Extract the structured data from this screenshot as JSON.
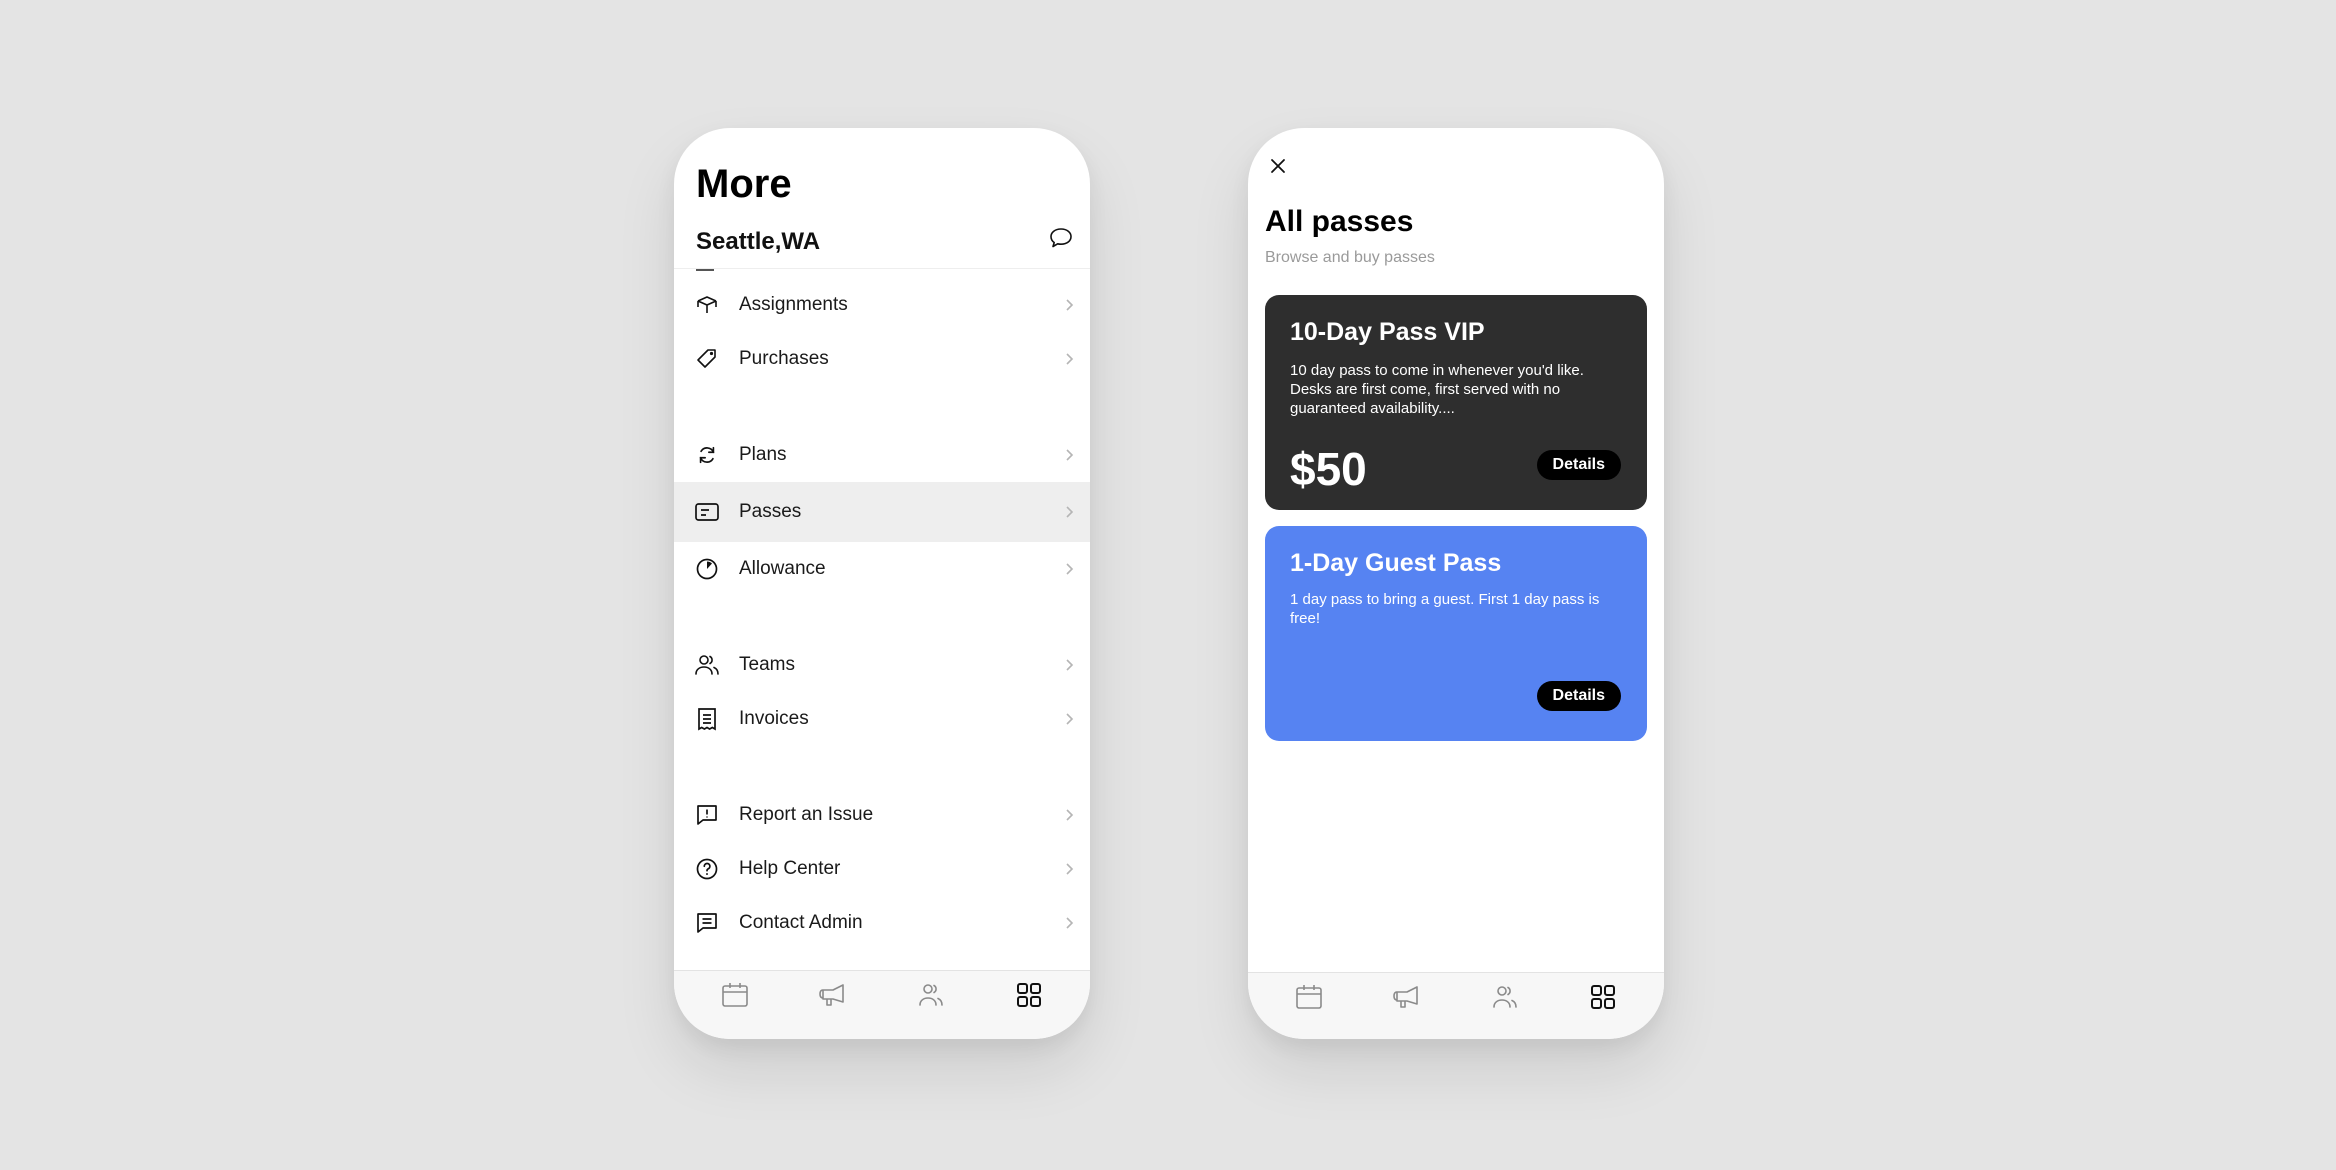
{
  "more_screen": {
    "title": "More",
    "location": "Seattle,WA",
    "chat_icon": "chat-bubble-icon",
    "groups": [
      [
        {
          "label": "Assignments",
          "icon": "box-icon"
        },
        {
          "label": "Purchases",
          "icon": "tag-icon"
        }
      ],
      [
        {
          "label": "Plans",
          "icon": "refresh-icon"
        },
        {
          "label": "Passes",
          "icon": "pass-card-icon",
          "active": true
        },
        {
          "label": "Allowance",
          "icon": "pie-timer-icon"
        }
      ],
      [
        {
          "label": "Teams",
          "icon": "users-icon"
        },
        {
          "label": "Invoices",
          "icon": "receipt-icon"
        }
      ],
      [
        {
          "label": "Report an Issue",
          "icon": "report-bubble-icon"
        },
        {
          "label": "Help Center",
          "icon": "help-circle-icon"
        },
        {
          "label": "Contact Admin",
          "icon": "message-icon"
        }
      ]
    ],
    "tabbar": [
      {
        "name": "calendar",
        "icon": "calendar-icon",
        "active": false
      },
      {
        "name": "announcements",
        "icon": "megaphone-icon",
        "active": false
      },
      {
        "name": "people",
        "icon": "users-icon",
        "active": false
      },
      {
        "name": "more",
        "icon": "grid-icon",
        "active": true
      }
    ]
  },
  "passes_screen": {
    "close_icon": "close-icon",
    "title": "All passes",
    "subtitle": "Browse and buy passes",
    "passes": [
      {
        "name": "10-Day Pass VIP",
        "description": "10 day pass to come in whenever you'd like. Desks are first come, first served with no guaranteed availability....",
        "price": "$50",
        "button": "Details",
        "color": "#2e2e2e"
      },
      {
        "name": "1-Day Guest Pass",
        "description": "1 day pass to bring a guest. First 1 day pass is free!",
        "price": "",
        "button": "Details",
        "color": "#5683f2"
      }
    ],
    "tabbar": [
      {
        "name": "calendar",
        "icon": "calendar-icon",
        "active": false
      },
      {
        "name": "announcements",
        "icon": "megaphone-icon",
        "active": false
      },
      {
        "name": "people",
        "icon": "users-icon",
        "active": false
      },
      {
        "name": "more",
        "icon": "grid-icon",
        "active": true
      }
    ]
  },
  "colors": {
    "background": "#e4e4e4",
    "active_row": "#eeeeee",
    "dark_card": "#2e2e2e",
    "blue_card": "#5683f2",
    "subtitle": "#9a9a9a"
  }
}
